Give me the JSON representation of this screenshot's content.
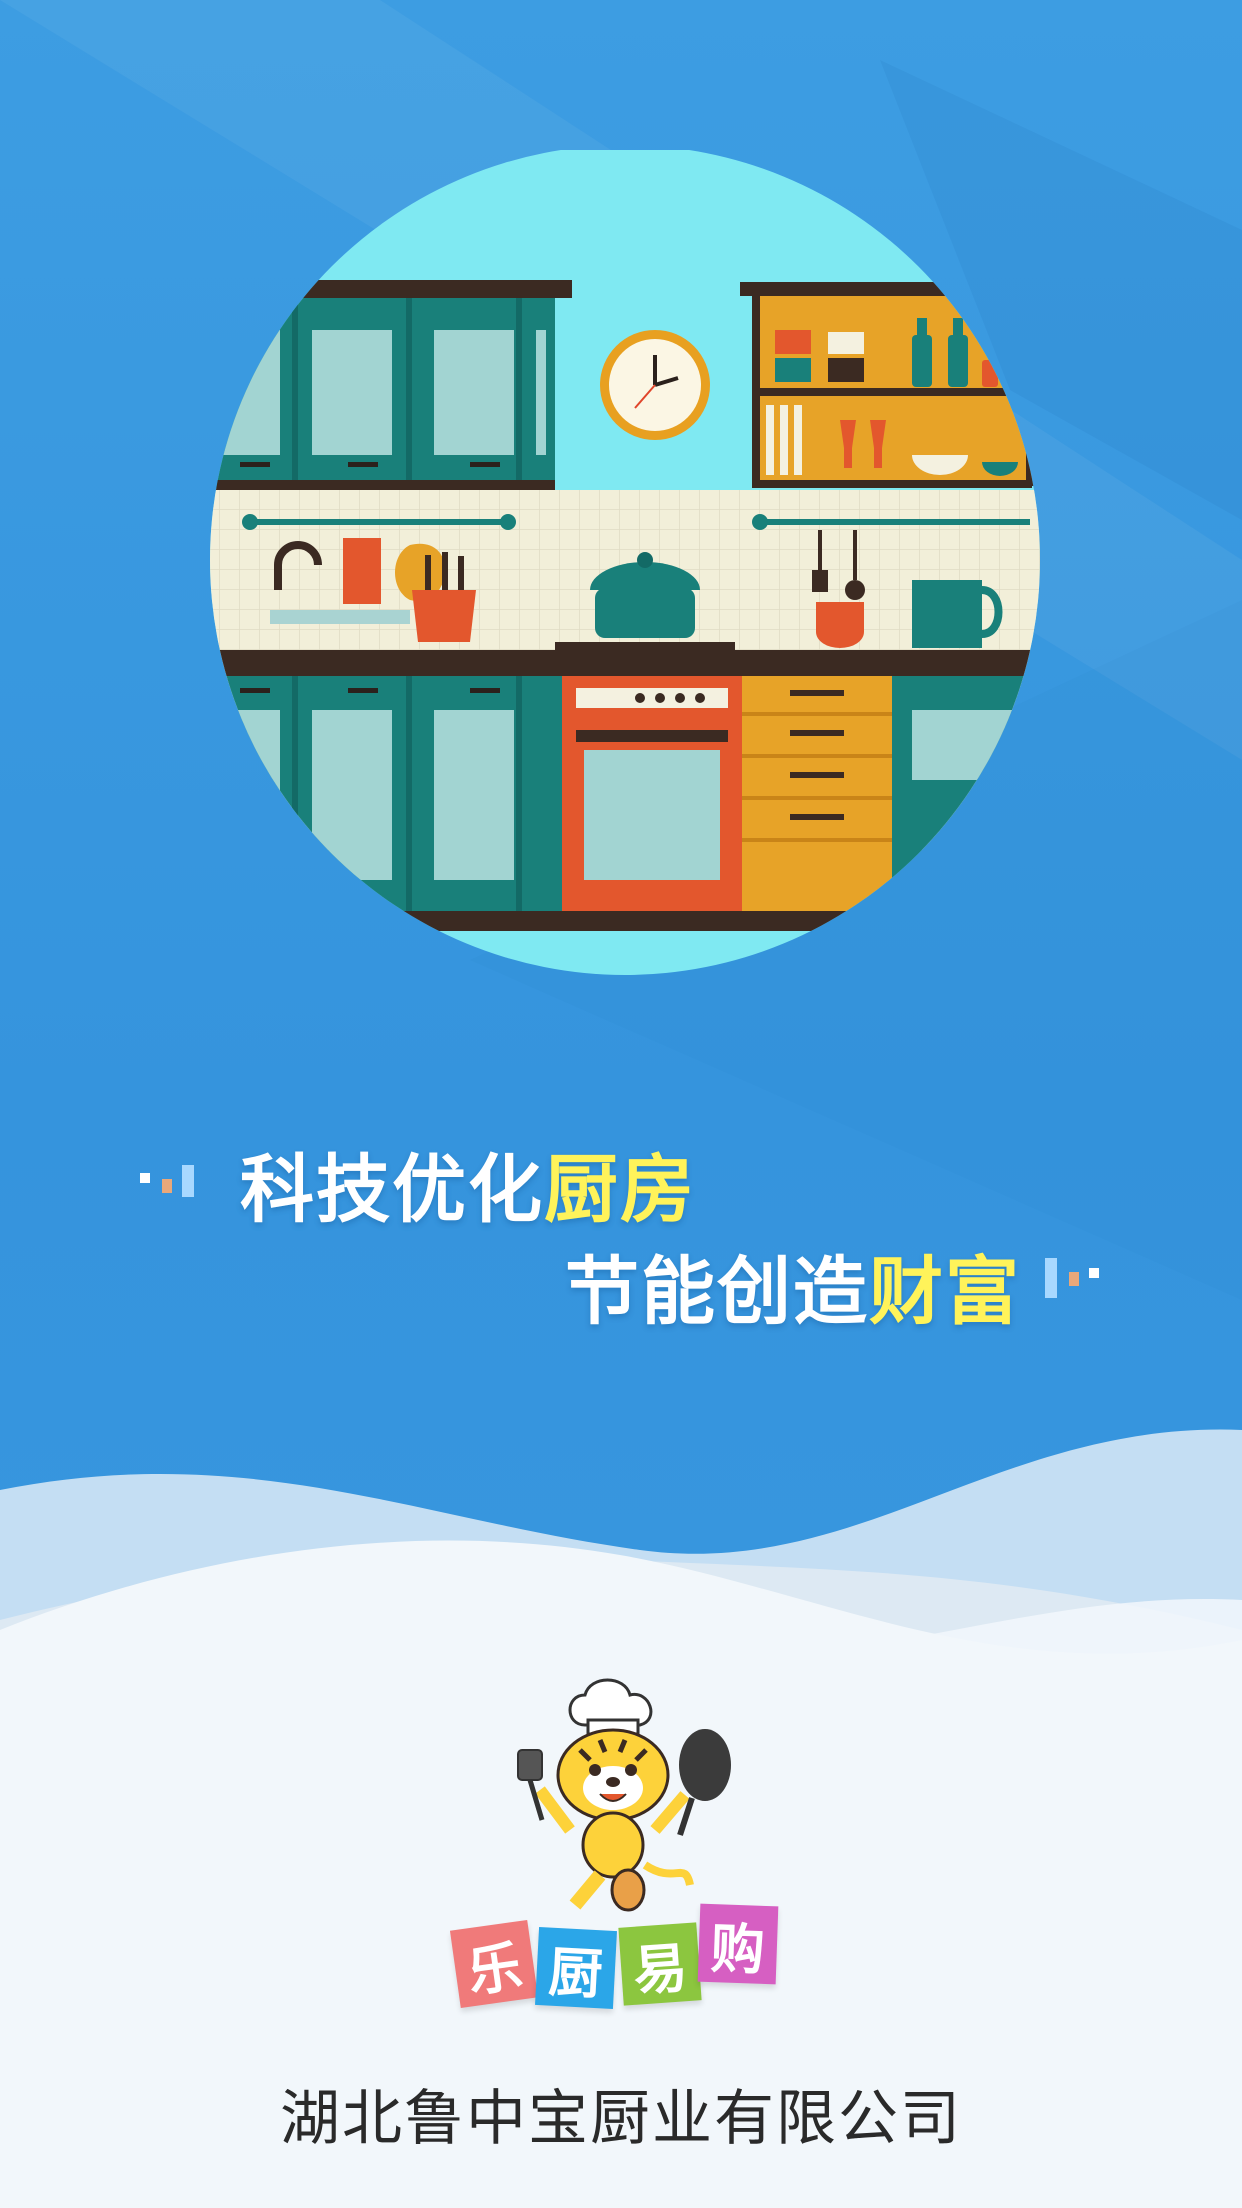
{
  "slogan": {
    "line1_plain": "科技优化",
    "line1_highlight": "厨房",
    "line2_plain": "节能创造",
    "line2_highlight": "财富"
  },
  "brand": {
    "chars": [
      "乐",
      "厨",
      "易",
      "购"
    ],
    "tile_colors": [
      "#f07a7a",
      "#2ba6e8",
      "#8cc63f",
      "#d65fc2"
    ]
  },
  "company": {
    "name": "湖北鲁中宝厨业有限公司"
  },
  "colors": {
    "background": "#3a9ae0",
    "slogan_text": "#ffffff",
    "slogan_highlight": "#fff35a",
    "footer_background": "#f2f7fb"
  },
  "icons": {
    "hero": "kitchen-illustration",
    "mascot": "tiger-chef-mascot"
  }
}
